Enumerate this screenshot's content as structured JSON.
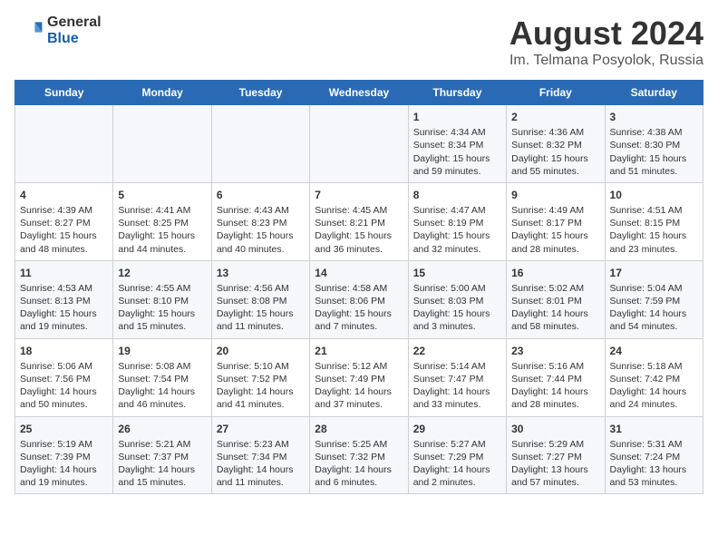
{
  "header": {
    "logo_general": "General",
    "logo_blue": "Blue",
    "main_title": "August 2024",
    "subtitle": "Im. Telmana Posyolok, Russia"
  },
  "columns": [
    "Sunday",
    "Monday",
    "Tuesday",
    "Wednesday",
    "Thursday",
    "Friday",
    "Saturday"
  ],
  "weeks": [
    {
      "days": [
        {
          "num": "",
          "content": ""
        },
        {
          "num": "",
          "content": ""
        },
        {
          "num": "",
          "content": ""
        },
        {
          "num": "",
          "content": ""
        },
        {
          "num": "1",
          "content": "Sunrise: 4:34 AM\nSunset: 8:34 PM\nDaylight: 15 hours\nand 59 minutes."
        },
        {
          "num": "2",
          "content": "Sunrise: 4:36 AM\nSunset: 8:32 PM\nDaylight: 15 hours\nand 55 minutes."
        },
        {
          "num": "3",
          "content": "Sunrise: 4:38 AM\nSunset: 8:30 PM\nDaylight: 15 hours\nand 51 minutes."
        }
      ]
    },
    {
      "days": [
        {
          "num": "4",
          "content": "Sunrise: 4:39 AM\nSunset: 8:27 PM\nDaylight: 15 hours\nand 48 minutes."
        },
        {
          "num": "5",
          "content": "Sunrise: 4:41 AM\nSunset: 8:25 PM\nDaylight: 15 hours\nand 44 minutes."
        },
        {
          "num": "6",
          "content": "Sunrise: 4:43 AM\nSunset: 8:23 PM\nDaylight: 15 hours\nand 40 minutes."
        },
        {
          "num": "7",
          "content": "Sunrise: 4:45 AM\nSunset: 8:21 PM\nDaylight: 15 hours\nand 36 minutes."
        },
        {
          "num": "8",
          "content": "Sunrise: 4:47 AM\nSunset: 8:19 PM\nDaylight: 15 hours\nand 32 minutes."
        },
        {
          "num": "9",
          "content": "Sunrise: 4:49 AM\nSunset: 8:17 PM\nDaylight: 15 hours\nand 28 minutes."
        },
        {
          "num": "10",
          "content": "Sunrise: 4:51 AM\nSunset: 8:15 PM\nDaylight: 15 hours\nand 23 minutes."
        }
      ]
    },
    {
      "days": [
        {
          "num": "11",
          "content": "Sunrise: 4:53 AM\nSunset: 8:13 PM\nDaylight: 15 hours\nand 19 minutes."
        },
        {
          "num": "12",
          "content": "Sunrise: 4:55 AM\nSunset: 8:10 PM\nDaylight: 15 hours\nand 15 minutes."
        },
        {
          "num": "13",
          "content": "Sunrise: 4:56 AM\nSunset: 8:08 PM\nDaylight: 15 hours\nand 11 minutes."
        },
        {
          "num": "14",
          "content": "Sunrise: 4:58 AM\nSunset: 8:06 PM\nDaylight: 15 hours\nand 7 minutes."
        },
        {
          "num": "15",
          "content": "Sunrise: 5:00 AM\nSunset: 8:03 PM\nDaylight: 15 hours\nand 3 minutes."
        },
        {
          "num": "16",
          "content": "Sunrise: 5:02 AM\nSunset: 8:01 PM\nDaylight: 14 hours\nand 58 minutes."
        },
        {
          "num": "17",
          "content": "Sunrise: 5:04 AM\nSunset: 7:59 PM\nDaylight: 14 hours\nand 54 minutes."
        }
      ]
    },
    {
      "days": [
        {
          "num": "18",
          "content": "Sunrise: 5:06 AM\nSunset: 7:56 PM\nDaylight: 14 hours\nand 50 minutes."
        },
        {
          "num": "19",
          "content": "Sunrise: 5:08 AM\nSunset: 7:54 PM\nDaylight: 14 hours\nand 46 minutes."
        },
        {
          "num": "20",
          "content": "Sunrise: 5:10 AM\nSunset: 7:52 PM\nDaylight: 14 hours\nand 41 minutes."
        },
        {
          "num": "21",
          "content": "Sunrise: 5:12 AM\nSunset: 7:49 PM\nDaylight: 14 hours\nand 37 minutes."
        },
        {
          "num": "22",
          "content": "Sunrise: 5:14 AM\nSunset: 7:47 PM\nDaylight: 14 hours\nand 33 minutes."
        },
        {
          "num": "23",
          "content": "Sunrise: 5:16 AM\nSunset: 7:44 PM\nDaylight: 14 hours\nand 28 minutes."
        },
        {
          "num": "24",
          "content": "Sunrise: 5:18 AM\nSunset: 7:42 PM\nDaylight: 14 hours\nand 24 minutes."
        }
      ]
    },
    {
      "days": [
        {
          "num": "25",
          "content": "Sunrise: 5:19 AM\nSunset: 7:39 PM\nDaylight: 14 hours\nand 19 minutes."
        },
        {
          "num": "26",
          "content": "Sunrise: 5:21 AM\nSunset: 7:37 PM\nDaylight: 14 hours\nand 15 minutes."
        },
        {
          "num": "27",
          "content": "Sunrise: 5:23 AM\nSunset: 7:34 PM\nDaylight: 14 hours\nand 11 minutes."
        },
        {
          "num": "28",
          "content": "Sunrise: 5:25 AM\nSunset: 7:32 PM\nDaylight: 14 hours\nand 6 minutes."
        },
        {
          "num": "29",
          "content": "Sunrise: 5:27 AM\nSunset: 7:29 PM\nDaylight: 14 hours\nand 2 minutes."
        },
        {
          "num": "30",
          "content": "Sunrise: 5:29 AM\nSunset: 7:27 PM\nDaylight: 13 hours\nand 57 minutes."
        },
        {
          "num": "31",
          "content": "Sunrise: 5:31 AM\nSunset: 7:24 PM\nDaylight: 13 hours\nand 53 minutes."
        }
      ]
    }
  ]
}
